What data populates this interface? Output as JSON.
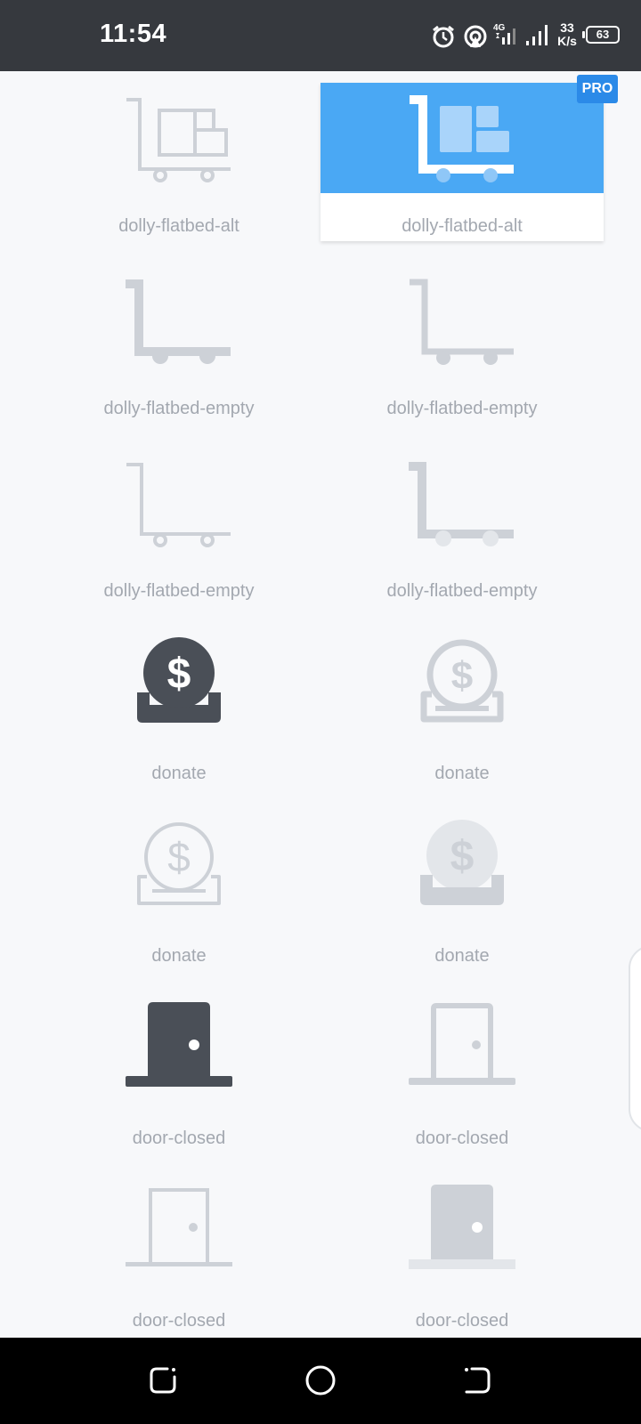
{
  "status_bar": {
    "time": "11:54",
    "net_speed_value": "33",
    "net_speed_unit": "K/s",
    "battery": "63",
    "network_type": "4G"
  },
  "colors": {
    "selected_tile": "#4aa8f4",
    "pro_badge": "#2b8ae8",
    "icon_dark": "#4a4f57",
    "icon_light": "#cdd1d7"
  },
  "grid": {
    "pro_badge": "PRO",
    "tiles": [
      {
        "label": "dolly-flatbed-alt",
        "icon": "dolly-flatbed-alt-light-icon"
      },
      {
        "label": "dolly-flatbed-alt",
        "icon": "dolly-flatbed-alt-duotone-icon"
      },
      {
        "label": "dolly-flatbed-empty",
        "icon": "dolly-flatbed-empty-solid-icon"
      },
      {
        "label": "dolly-flatbed-empty",
        "icon": "dolly-flatbed-empty-regular-icon"
      },
      {
        "label": "dolly-flatbed-empty",
        "icon": "dolly-flatbed-empty-light-icon"
      },
      {
        "label": "dolly-flatbed-empty",
        "icon": "dolly-flatbed-empty-duotone-icon"
      },
      {
        "label": "donate",
        "icon": "donate-solid-icon"
      },
      {
        "label": "donate",
        "icon": "donate-regular-icon"
      },
      {
        "label": "donate",
        "icon": "donate-light-icon"
      },
      {
        "label": "donate",
        "icon": "donate-duotone-icon"
      },
      {
        "label": "door-closed",
        "icon": "door-closed-solid-icon"
      },
      {
        "label": "door-closed",
        "icon": "door-closed-regular-icon"
      },
      {
        "label": "door-closed",
        "icon": "door-closed-light-icon"
      },
      {
        "label": "door-closed",
        "icon": "door-closed-duotone-icon"
      }
    ]
  },
  "nav_bar": {
    "buttons": [
      "recents-icon",
      "home-icon",
      "back-icon"
    ]
  }
}
